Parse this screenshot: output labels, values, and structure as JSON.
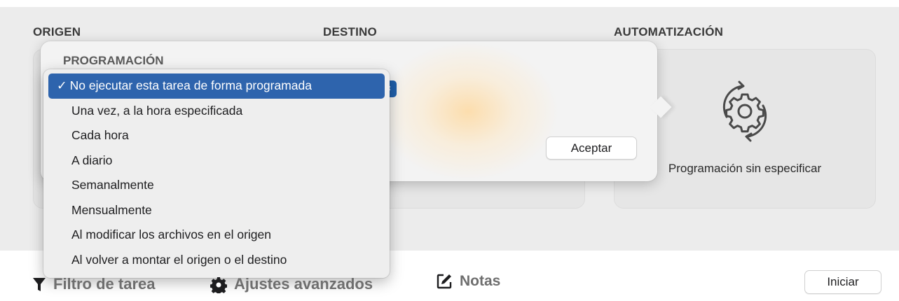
{
  "sections": {
    "origin": "ORIGEN",
    "destination": "DESTINO",
    "automation": "AUTOMATIZACIÓN"
  },
  "automation_panel": {
    "icon": "gear-sync-icon",
    "label": "Programación sin especificar"
  },
  "popover": {
    "title": "PROGRAMACIÓN",
    "accept_label": "Aceptar"
  },
  "schedule_menu": {
    "check_mark": "✓",
    "selected_index": 0,
    "items": [
      "No ejecutar esta tarea de forma programada",
      "Una vez, a la hora especificada",
      "Cada hora",
      "A diario",
      "Semanalmente",
      "Mensualmente",
      "Al modificar los archivos en el origen",
      "Al volver a montar el origen o el destino"
    ]
  },
  "toolbar": {
    "filter_label": "Filtro de tarea",
    "filter_icon": "funnel-icon",
    "advanced_label": "Ajustes avanzados",
    "advanced_icon": "gear-icon",
    "notes_label": "Notas",
    "notes_icon": "note-edit-icon",
    "start_label": "Iniciar"
  },
  "colors": {
    "accent": "#2e64ad",
    "background": "#ececec"
  }
}
